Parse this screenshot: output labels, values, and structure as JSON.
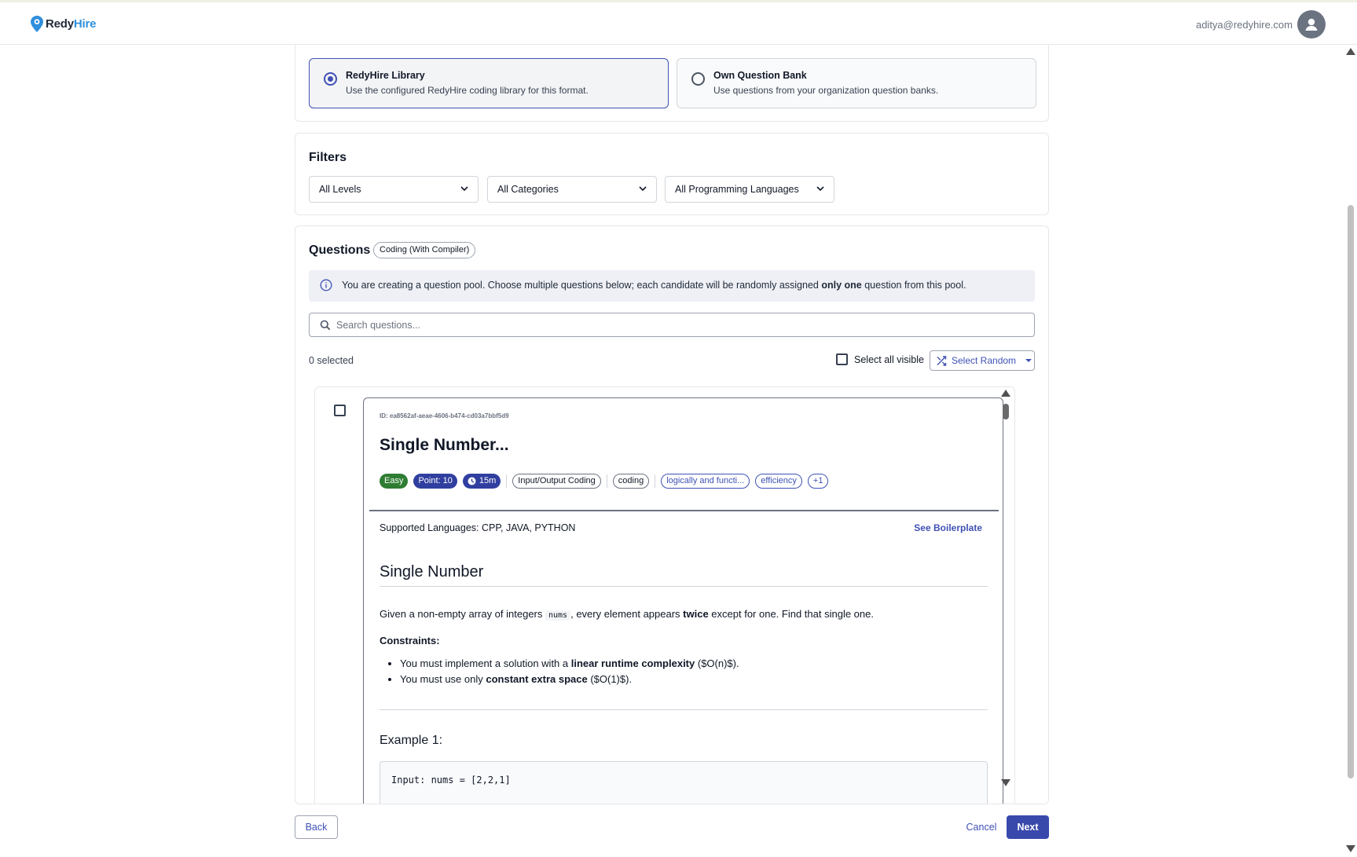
{
  "header": {
    "logo_part1": "Redy",
    "logo_part2": "Hire",
    "user_email": "aditya@redyhire.com"
  },
  "source": {
    "options": [
      {
        "title": "RedyHire Library",
        "description": "Use the configured RedyHire coding library for this format.",
        "selected": true
      },
      {
        "title": "Own Question Bank",
        "description": "Use questions from your organization question banks.",
        "selected": false
      }
    ]
  },
  "filters": {
    "title": "Filters",
    "levels": "All Levels",
    "categories": "All Categories",
    "languages": "All Programming Languages"
  },
  "questions": {
    "title": "Questions",
    "type_badge": "Coding (With Compiler)",
    "info_prefix": "You are creating a question pool. Choose multiple questions below; each candidate will be randomly assigned ",
    "info_bold": "only one",
    "info_suffix": " question from this pool.",
    "search_placeholder": "Search questions...",
    "selected_count": "0 selected",
    "select_all_label": "Select all visible",
    "select_random_label": "Select Random"
  },
  "question_card": {
    "id": "ID: ea8562af-aeae-4606-b474-cd03a7bbf5d9",
    "name": "Single Number...",
    "tags": {
      "level": "Easy",
      "points": "Point: 10",
      "time": "15m",
      "type": "Input/Output Coding",
      "category": "coding",
      "skill1": "logically and functi...",
      "skill2": "efficiency",
      "more": "+1"
    },
    "supported_languages": "Supported Languages: CPP, JAVA, PYTHON",
    "boilerplate_link": "See Boilerplate",
    "problem_title": "Single Number",
    "desc_part1": "Given a non-empty array of integers ",
    "desc_code": "nums",
    "desc_part2": ", every element appears ",
    "desc_bold": "twice",
    "desc_part3": " except for one. Find that single one.",
    "constraints_label": "Constraints:",
    "constraint1_pre": "You must implement a solution with a ",
    "constraint1_bold": "linear runtime complexity",
    "constraint1_post": " ($O(n)$).",
    "constraint2_pre": "You must use only ",
    "constraint2_bold": "constant extra space",
    "constraint2_post": " ($O(1)$).",
    "example_title": "Example 1:",
    "example_input": "Input: nums = [2,2,1]"
  },
  "footer": {
    "back": "Back",
    "cancel": "Cancel",
    "next": "Next"
  },
  "colors": {
    "primary": "#3f51b5",
    "easy": "#2e7d32",
    "brand_blue": "#2f8fdc"
  }
}
